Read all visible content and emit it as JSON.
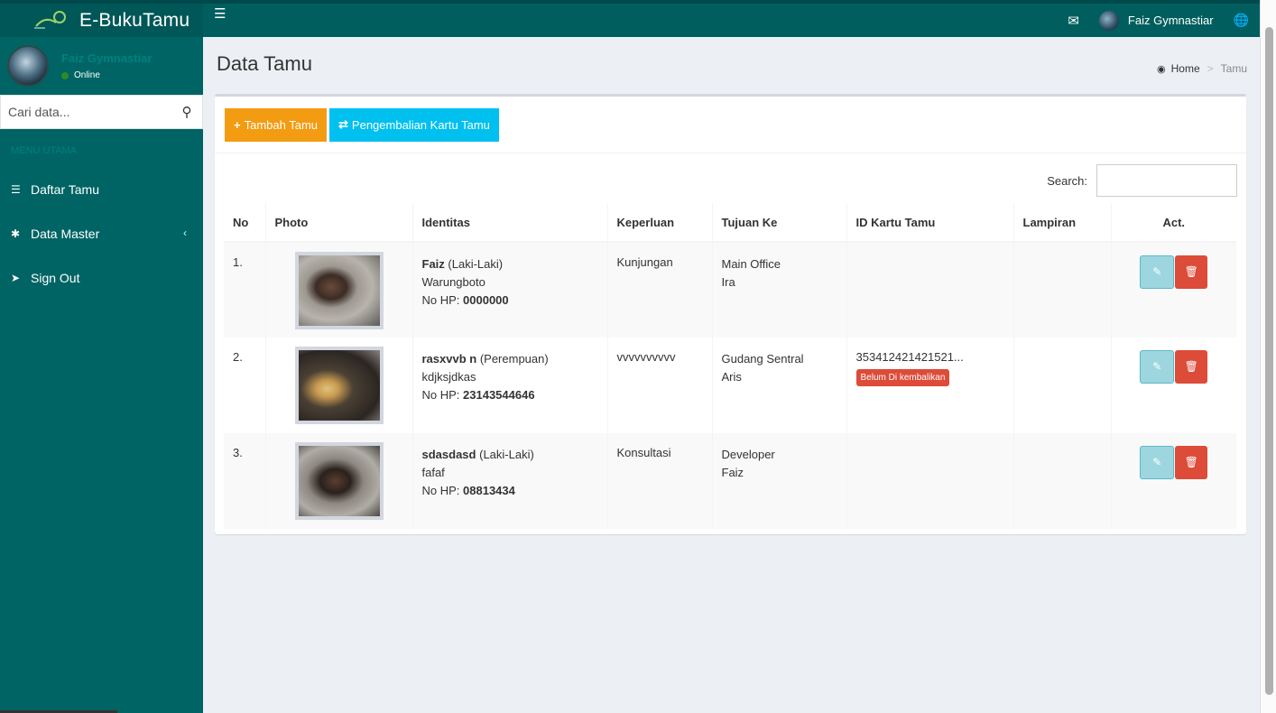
{
  "header": {
    "brand": "E-BukuTamu",
    "user_name": "Faiz Gymnastiar"
  },
  "sidebar": {
    "user_name": "Faiz Gymnastiar",
    "status": "Online",
    "search_placeholder": "Cari data...",
    "menu_header": "MENU UTAMA",
    "items": [
      {
        "label": "Daftar Tamu",
        "icon": "list-icon"
      },
      {
        "label": "Data Master",
        "icon": "gear-icon"
      },
      {
        "label": "Sign Out",
        "icon": "sign-out-icon"
      }
    ]
  },
  "page": {
    "title": "Data Tamu",
    "breadcrumb": {
      "home": "Home",
      "current": "Tamu"
    }
  },
  "toolbar": {
    "add_label": "Tambah Tamu",
    "return_label": "Pengembalian Kartu Tamu"
  },
  "table": {
    "search_label": "Search:",
    "columns": [
      "No",
      "Photo",
      "Identitas",
      "Keperluan",
      "Tujuan Ke",
      "ID Kartu Tamu",
      "Lampiran",
      "Act."
    ],
    "rows": [
      {
        "no": "1.",
        "name": "Faiz",
        "gender": "(Laki-Laki)",
        "address": "Warungboto",
        "hp_label": "No HP:",
        "hp": "0000000",
        "keperluan": "Kunjungan",
        "tujuan_1": "Main Office",
        "tujuan_2": "Ira",
        "id_kartu": "",
        "badge": ""
      },
      {
        "no": "2.",
        "name": "rasxvvb n",
        "gender": "(Perempuan)",
        "address": "kdjksjdkas",
        "hp_label": "No HP:",
        "hp": "23143544646",
        "keperluan": "vvvvvvvvvv",
        "tujuan_1": "Gudang Sentral",
        "tujuan_2": "Aris",
        "id_kartu": "353412421421521...",
        "badge": "Belum Di kembalikan"
      },
      {
        "no": "3.",
        "name": "sdasdasd",
        "gender": "(Laki-Laki)",
        "address": "fafaf",
        "hp_label": "No HP:",
        "hp": "08813434",
        "keperluan": "Konsultasi",
        "tujuan_1": "Developer",
        "tujuan_2": "Faiz",
        "id_kartu": "",
        "badge": ""
      }
    ]
  },
  "colors": {
    "header": "#005e5e",
    "sidebar": "#006464",
    "warning": "#f39c12",
    "info": "#00c0ef",
    "danger": "#dd4b39"
  }
}
